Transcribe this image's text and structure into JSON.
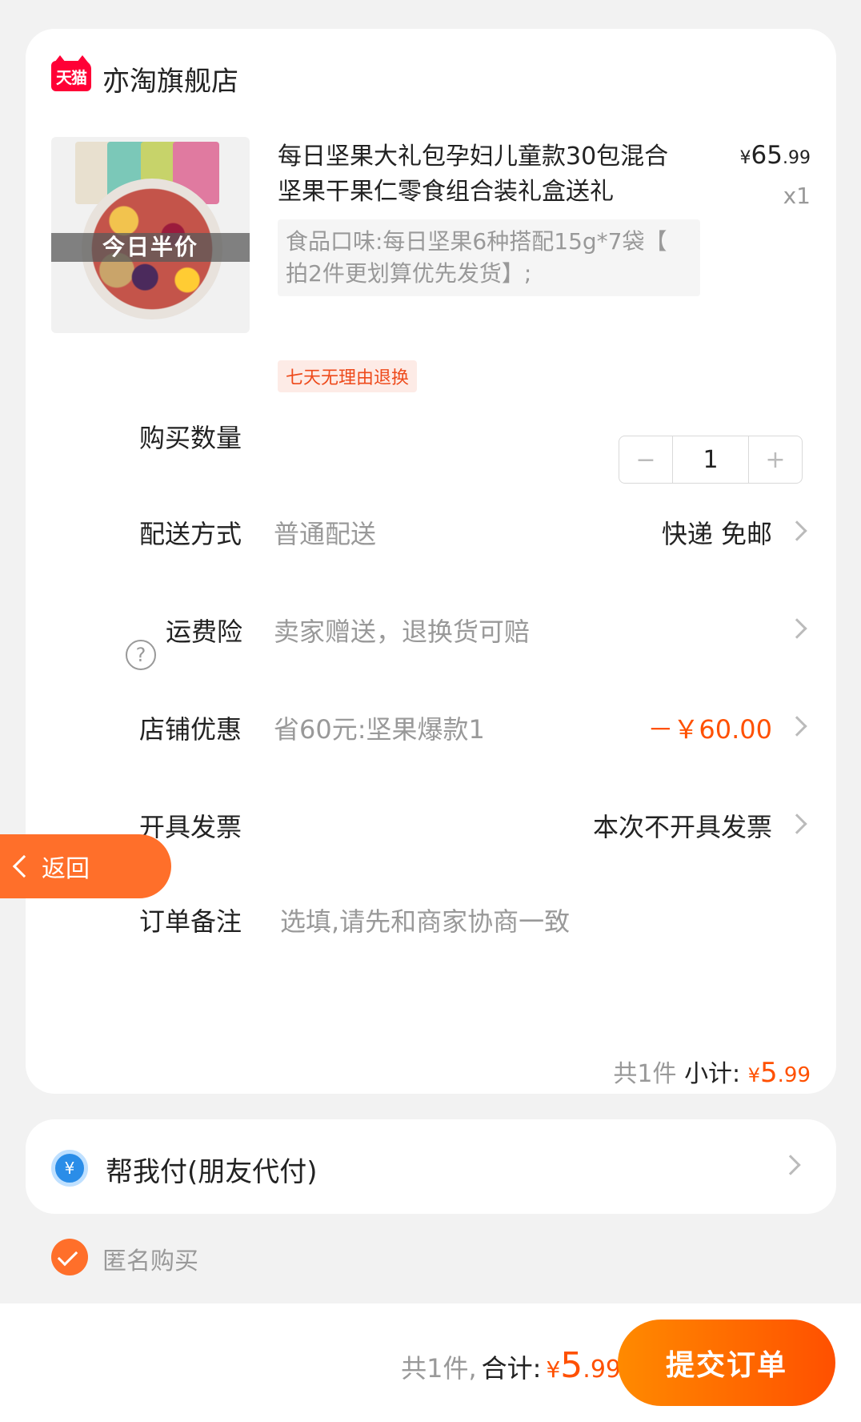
{
  "shop": {
    "logo_text": "天猫",
    "name": "亦淘旗舰店"
  },
  "product": {
    "banner": "今日半价",
    "title": "每日坚果大礼包孕妇儿童款30包混合坚果干果仁零食组合装礼盒送礼",
    "price_symbol": "¥",
    "price_int": "65",
    "price_dec": ".99",
    "quantity_label": "x1",
    "sku": "食品口味:每日坚果6种搭配15g*7袋【 拍2件更划算优先发货】;",
    "tag": "七天无理由退换"
  },
  "rows": {
    "quantity": {
      "label": "购买数量",
      "minus": "−",
      "value": "1",
      "plus": "+"
    },
    "delivery": {
      "label": "配送方式",
      "sub": "普通配送",
      "value": "快递 免邮"
    },
    "insurance": {
      "label": "运费险",
      "sub": "卖家赠送，退换货可赔"
    },
    "discount": {
      "label": "店铺优惠",
      "sub": "省60元:坚果爆款1",
      "value": "－￥60.00"
    },
    "invoice": {
      "label": "开具发票",
      "value": "本次不开具发票"
    },
    "note": {
      "label": "订单备注",
      "placeholder": "选填,请先和商家协商一致"
    }
  },
  "back_button": {
    "label": "返回"
  },
  "subtotal": {
    "count": "共1件",
    "label": "小计:",
    "symbol": "¥",
    "int": "5",
    "dec": ".99"
  },
  "pay_for_me": {
    "icon": "¥",
    "label": "帮我付(朋友代付)"
  },
  "anonymous": {
    "label": "匿名购买",
    "checked": true
  },
  "footer": {
    "count": "共1件,",
    "label": "合计:",
    "symbol": "¥",
    "int": "5",
    "dec": ".99",
    "submit": "提交订单"
  },
  "colors": {
    "accent": "#ff5000",
    "tmall_red": "#ff0036",
    "back_orange": "#ff6f2a"
  }
}
